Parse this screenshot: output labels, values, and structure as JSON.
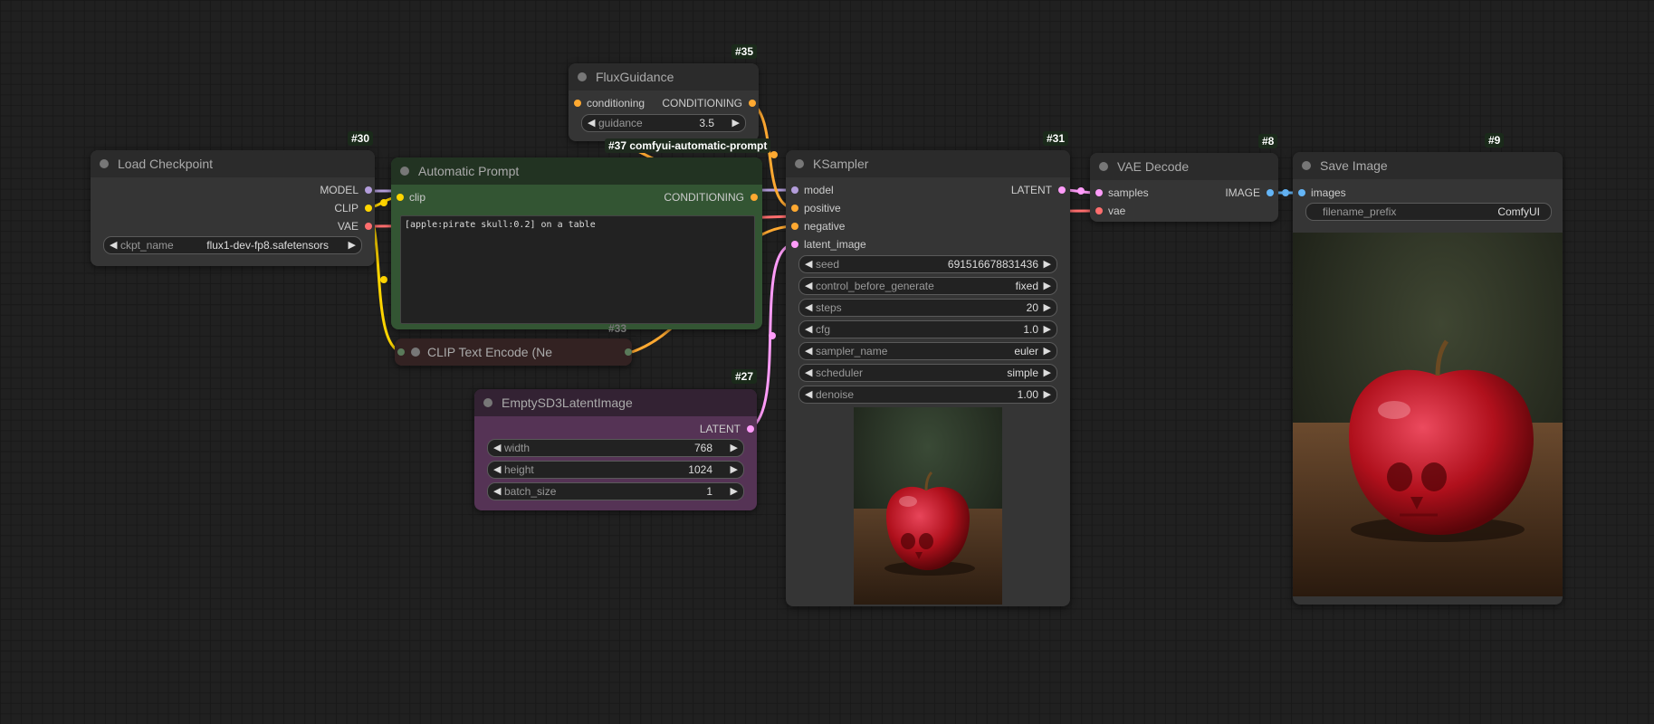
{
  "colors": {
    "model": "#b39ddb",
    "clip": "#ffd500",
    "vae": "#ff6e6e",
    "conditioning": "#ffa931",
    "latent": "#ff9cf9",
    "image": "#64b5f6"
  },
  "nodes": {
    "load_checkpoint": {
      "id": "#30",
      "title": "Load Checkpoint",
      "outputs": [
        "MODEL",
        "CLIP",
        "VAE"
      ],
      "ckpt_name": {
        "label": "ckpt_name",
        "value": "flux1-dev-fp8.safetensors"
      }
    },
    "flux_guidance": {
      "id": "#35",
      "title": "FluxGuidance",
      "input": "conditioning",
      "output": "CONDITIONING",
      "guidance": {
        "label": "guidance",
        "value": "3.5"
      }
    },
    "automatic_prompt": {
      "id": "#37 comfyui-automatic-prompt",
      "title": "Automatic Prompt",
      "input": "clip",
      "output": "CONDITIONING",
      "text": "[apple:pirate skull:0.2] on a table"
    },
    "clip_text_encode": {
      "id": "#33",
      "title": "CLIP Text Encode (Ne"
    },
    "empty_latent": {
      "id": "#27",
      "title": "EmptySD3LatentImage",
      "output": "LATENT",
      "width": {
        "label": "width",
        "value": "768"
      },
      "height": {
        "label": "height",
        "value": "1024"
      },
      "batch_size": {
        "label": "batch_size",
        "value": "1"
      }
    },
    "ksampler": {
      "id": "#31",
      "title": "KSampler",
      "inputs": [
        "model",
        "positive",
        "negative",
        "latent_image"
      ],
      "output": "LATENT",
      "widgets": [
        {
          "label": "seed",
          "value": "691516678831436"
        },
        {
          "label": "control_before_generate",
          "value": "fixed"
        },
        {
          "label": "steps",
          "value": "20"
        },
        {
          "label": "cfg",
          "value": "1.0"
        },
        {
          "label": "sampler_name",
          "value": "euler"
        },
        {
          "label": "scheduler",
          "value": "simple"
        },
        {
          "label": "denoise",
          "value": "1.00"
        }
      ]
    },
    "vae_decode": {
      "id": "#8",
      "title": "VAE Decode",
      "inputs": [
        "samples",
        "vae"
      ],
      "output": "IMAGE"
    },
    "save_image": {
      "id": "#9",
      "title": "Save Image",
      "input": "images",
      "filename_prefix": {
        "label": "filename_prefix",
        "value": "ComfyUI"
      }
    }
  },
  "icons": {
    "arrow_left": "◀",
    "arrow_right": "▶"
  }
}
